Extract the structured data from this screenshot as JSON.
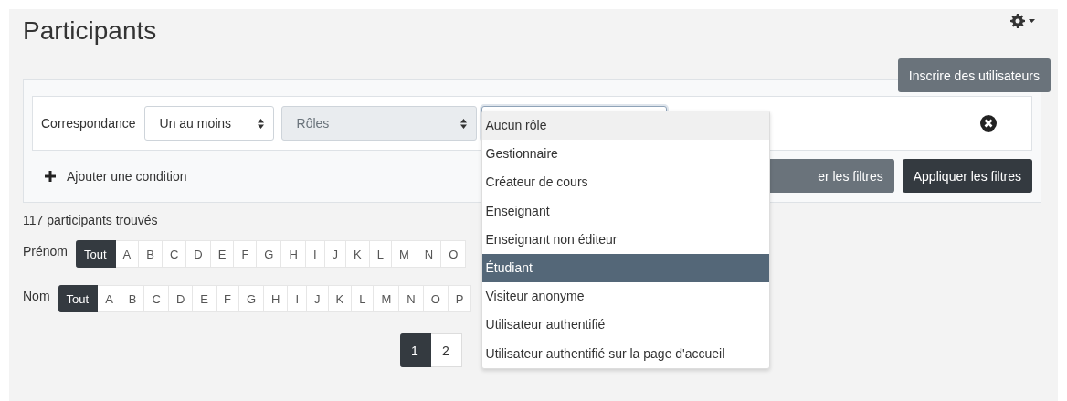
{
  "page_title": "Participants",
  "enrol_button": "Inscrire des utilisateurs",
  "filter": {
    "match_label": "Correspondance",
    "match_select": "Un au moins",
    "type_select": {
      "placeholder": "Rôles"
    },
    "dropdown": [
      {
        "label": "Aucun rôle",
        "hovered": true,
        "selected": false
      },
      {
        "label": "Gestionnaire",
        "hovered": false,
        "selected": false
      },
      {
        "label": "Créateur de cours",
        "hovered": false,
        "selected": false
      },
      {
        "label": "Enseignant",
        "hovered": false,
        "selected": false
      },
      {
        "label": "Enseignant non éditeur",
        "hovered": false,
        "selected": false
      },
      {
        "label": "Étudiant",
        "hovered": false,
        "selected": true
      },
      {
        "label": "Visiteur anonyme",
        "hovered": false,
        "selected": false
      },
      {
        "label": "Utilisateur authentifié",
        "hovered": false,
        "selected": false
      },
      {
        "label": "Utilisateur authentifié sur la page d'accueil",
        "hovered": false,
        "selected": false
      }
    ],
    "add_condition": "Ajouter une condition",
    "reset_button": "er les filtres",
    "apply_button": "Appliquer les filtres"
  },
  "count": "117 participants trouvés",
  "initials": [
    {
      "label": "Prénom",
      "letters": [
        {
          "label": "Tout",
          "selected": true
        },
        {
          "label": "A",
          "selected": false
        },
        {
          "label": "B",
          "selected": false
        },
        {
          "label": "C",
          "selected": false
        },
        {
          "label": "D",
          "selected": false
        },
        {
          "label": "E",
          "selected": false
        },
        {
          "label": "F",
          "selected": false
        },
        {
          "label": "G",
          "selected": false
        },
        {
          "label": "H",
          "selected": false
        },
        {
          "label": "I",
          "selected": false
        },
        {
          "label": "J",
          "selected": false
        },
        {
          "label": "K",
          "selected": false
        },
        {
          "label": "L",
          "selected": false
        },
        {
          "label": "M",
          "selected": false
        },
        {
          "label": "N",
          "selected": false
        },
        {
          "label": "O",
          "selected": false
        }
      ]
    },
    {
      "label": "Nom",
      "letters": [
        {
          "label": "Tout",
          "selected": true
        },
        {
          "label": "A",
          "selected": false
        },
        {
          "label": "B",
          "selected": false
        },
        {
          "label": "C",
          "selected": false
        },
        {
          "label": "D",
          "selected": false
        },
        {
          "label": "E",
          "selected": false
        },
        {
          "label": "F",
          "selected": false
        },
        {
          "label": "G",
          "selected": false
        },
        {
          "label": "H",
          "selected": false
        },
        {
          "label": "I",
          "selected": false
        },
        {
          "label": "J",
          "selected": false
        },
        {
          "label": "K",
          "selected": false
        },
        {
          "label": "L",
          "selected": false
        },
        {
          "label": "M",
          "selected": false
        },
        {
          "label": "N",
          "selected": false
        },
        {
          "label": "O",
          "selected": false
        },
        {
          "label": "P",
          "selected": false
        }
      ]
    }
  ],
  "pagination": [
    {
      "label": "1",
      "selected": true
    },
    {
      "label": "2",
      "selected": false
    }
  ]
}
